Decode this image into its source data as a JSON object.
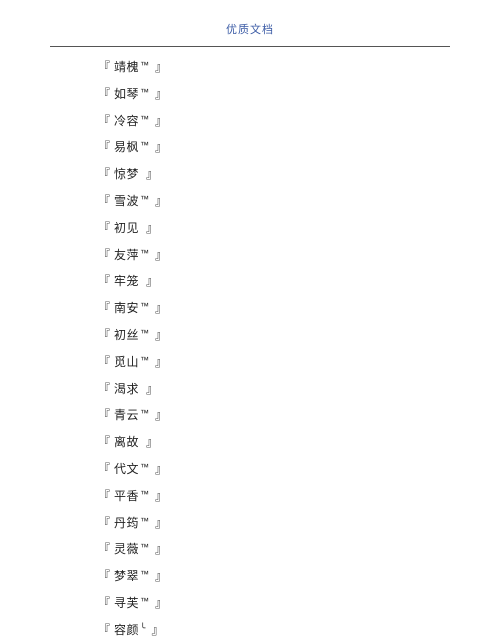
{
  "header": {
    "title": "优质文档"
  },
  "brackets": {
    "open": "『",
    "close": "』"
  },
  "items": [
    {
      "name": "靖槐",
      "suffix": "™"
    },
    {
      "name": "如琴",
      "suffix": "™"
    },
    {
      "name": "冷容",
      "suffix": "™"
    },
    {
      "name": "易枫",
      "suffix": "™"
    },
    {
      "name": "惊梦",
      "suffix": ""
    },
    {
      "name": "雪波",
      "suffix": "™"
    },
    {
      "name": "初见",
      "suffix": ""
    },
    {
      "name": "友萍",
      "suffix": "™"
    },
    {
      "name": "牢笼",
      "suffix": ""
    },
    {
      "name": "南安",
      "suffix": "™"
    },
    {
      "name": "初丝",
      "suffix": "™"
    },
    {
      "name": "觅山",
      "suffix": "™"
    },
    {
      "name": "渴求",
      "suffix": ""
    },
    {
      "name": "青云",
      "suffix": "™"
    },
    {
      "name": "离故",
      "suffix": ""
    },
    {
      "name": "代文",
      "suffix": "™"
    },
    {
      "name": "平香",
      "suffix": "™"
    },
    {
      "name": "丹筠",
      "suffix": "™"
    },
    {
      "name": "灵薇",
      "suffix": "™"
    },
    {
      "name": "梦翠",
      "suffix": "™"
    },
    {
      "name": "寻芙",
      "suffix": "™"
    },
    {
      "name": "容颜",
      "suffix": "╰"
    }
  ]
}
